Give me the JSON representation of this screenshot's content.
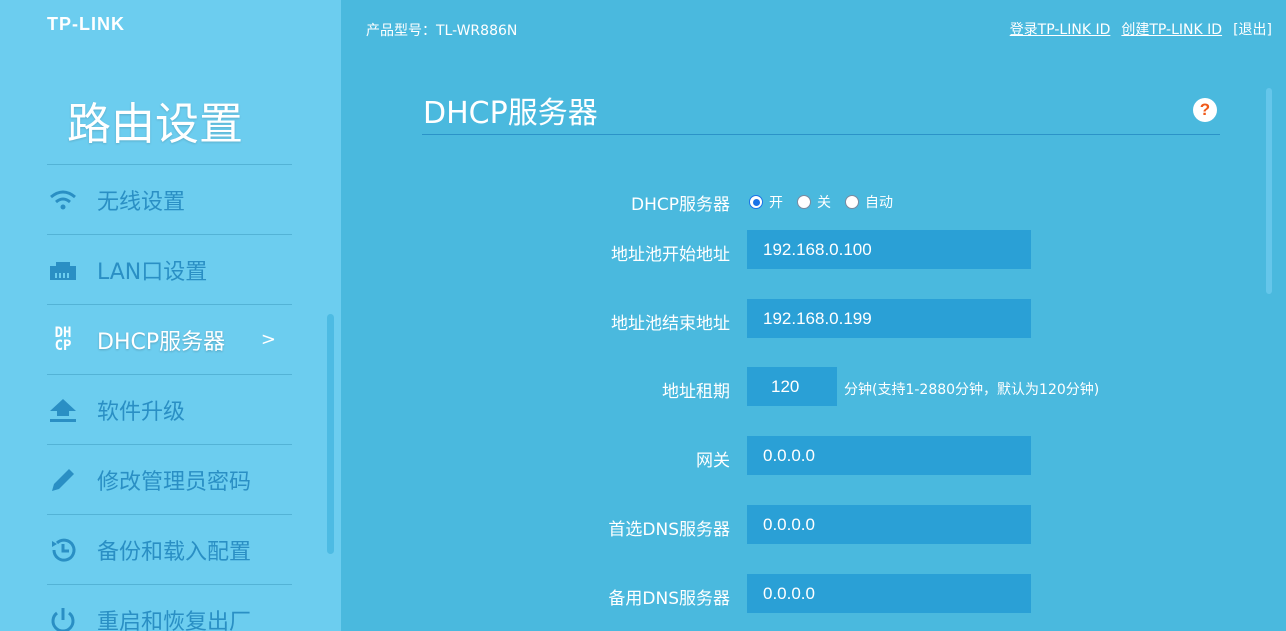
{
  "brand": "TP-LINK",
  "sidebar": {
    "title": "路由设置",
    "items": [
      {
        "label": "无线设置",
        "icon": "wifi-icon"
      },
      {
        "label": "LAN口设置",
        "icon": "lan-port-icon"
      },
      {
        "label": "DHCP服务器",
        "icon": "dhcp-icon",
        "active": true,
        "arrow": ">"
      },
      {
        "label": "软件升级",
        "icon": "upload-icon"
      },
      {
        "label": "修改管理员密码",
        "icon": "pencil-icon"
      },
      {
        "label": "备份和载入配置",
        "icon": "history-icon"
      },
      {
        "label": "重启和恢复出厂",
        "icon": "power-icon"
      }
    ]
  },
  "topbar": {
    "model": "产品型号：TL-WR886N",
    "login_link": "登录TP-LINK ID",
    "create_link": "创建TP-LINK ID",
    "logout": "[退出]"
  },
  "main": {
    "title": "DHCP服务器",
    "help": "?",
    "dhcp": {
      "label": "DHCP服务器",
      "options": [
        "开",
        "关",
        "自动"
      ],
      "selected": "开"
    },
    "pool_start": {
      "label": "地址池开始地址",
      "value": "192.168.0.100"
    },
    "pool_end": {
      "label": "地址池结束地址",
      "value": "192.168.0.199"
    },
    "lease": {
      "label": "地址租期",
      "value": "120",
      "hint": "分钟(支持1-2880分钟，默认为120分钟)"
    },
    "gateway": {
      "label": "网关",
      "value": "0.0.0.0"
    },
    "dns1": {
      "label": "首选DNS服务器",
      "value": "0.0.0.0"
    },
    "dns2": {
      "label": "备用DNS服务器",
      "value": "0.0.0.0"
    }
  },
  "colors": {
    "sidebar_bg": "#6ccdef",
    "main_bg": "#4ab9de",
    "field_bg": "#2aa0d6",
    "help_accent": "#f05a1a"
  }
}
